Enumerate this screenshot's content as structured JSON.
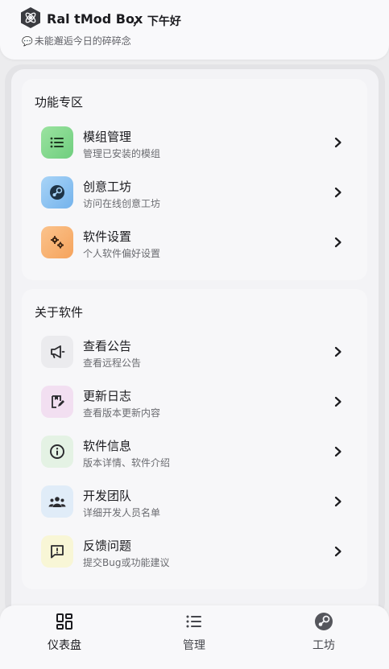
{
  "header": {
    "app_name": "Ral tMod Box",
    "greeting": "， 下午好",
    "subtitle_emoji": "💬",
    "subtitle": "未能邂逅今日的碎碎念"
  },
  "sections": [
    {
      "title": "功能专区",
      "items": [
        {
          "title": "模组管理",
          "desc": "管理已安装的模组",
          "icon": "list-icon",
          "color": "#7fd88a"
        },
        {
          "title": "创意工坊",
          "desc": "访问在线创意工坊",
          "icon": "steam-icon",
          "color": "#86bff0"
        },
        {
          "title": "软件设置",
          "desc": "个人软件偏好设置",
          "icon": "gears-icon",
          "color": "#f7b06e"
        }
      ]
    },
    {
      "title": "关于软件",
      "items": [
        {
          "title": "查看公告",
          "desc": "查看远程公告",
          "icon": "megaphone-icon",
          "color": "#ebebee"
        },
        {
          "title": "更新日志",
          "desc": "查看版本更新内容",
          "icon": "edit-note-icon",
          "color": "#f2dff1"
        },
        {
          "title": "软件信息",
          "desc": "版本详情、软件介绍",
          "icon": "info-icon",
          "color": "#e4f2e4"
        },
        {
          "title": "开发团队",
          "desc": "详细开发人员名单",
          "icon": "team-icon",
          "color": "#e0ecf8"
        },
        {
          "title": "反馈问题",
          "desc": "提交Bug或功能建议",
          "icon": "feedback-icon",
          "color": "#f8f6d6"
        }
      ]
    }
  ],
  "nav": {
    "items": [
      {
        "label": "仪表盘",
        "icon": "dashboard-icon",
        "active": true
      },
      {
        "label": "管理",
        "icon": "list-icon",
        "active": false
      },
      {
        "label": "工坊",
        "icon": "steam-icon",
        "active": false
      }
    ]
  }
}
